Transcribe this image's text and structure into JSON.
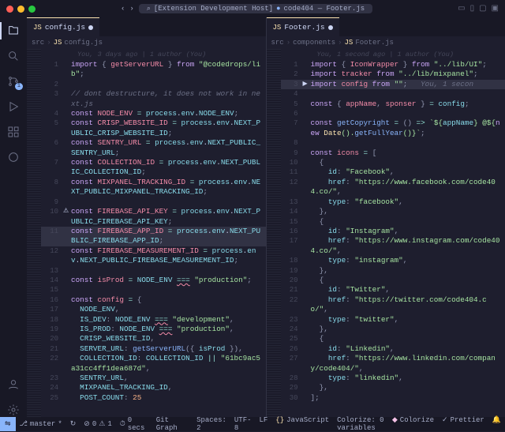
{
  "titlebar": {
    "search": "[Extension Development Host]",
    "project": "code404 — Footer.js"
  },
  "activity": {
    "scm_badge": "1"
  },
  "left": {
    "tab": "config.js",
    "crumbs": [
      "src",
      "config.js"
    ],
    "blame": "You, 3 days ago | 1 author (You)",
    "lines": [
      {
        "n": 1,
        "g": "",
        "html": "<span class='kw'>import</span> <span class='pun'>{</span> <span class='var'>getServerURL</span> <span class='pun'>}</span> <span class='kw'>from</span> <span class='str'>\"@codedrops/lib\"</span><span class='pun'>;</span>"
      },
      {
        "n": 2,
        "g": "",
        "html": ""
      },
      {
        "n": 3,
        "g": "",
        "html": "<span class='cm'>// dont destructure, it does not work in next.js</span>"
      },
      {
        "n": 4,
        "g": "",
        "html": "<span class='kw'>const</span> <span class='var'>NODE_ENV</span> <span class='op'>=</span> <span class='prop'>process</span>.<span class='prop'>env</span>.<span class='prop'>NODE_ENV</span><span class='pun'>;</span>"
      },
      {
        "n": 5,
        "g": "",
        "html": "<span class='kw'>const</span> <span class='var'>CRISP_WEBSITE_ID</span> <span class='op'>=</span> <span class='prop'>process</span>.<span class='prop'>env</span>.<span class='prop'>NEXT_PUBLIC_CRISP_WEBSITE_ID</span><span class='pun'>;</span>"
      },
      {
        "n": 6,
        "g": "",
        "html": "<span class='kw'>const</span> <span class='var'>SENTRY_URL</span> <span class='op'>=</span> <span class='prop'>process</span>.<span class='prop'>env</span>.<span class='prop'>NEXT_PUBLIC_SENTRY_URL</span><span class='pun'>;</span>"
      },
      {
        "n": 7,
        "g": "",
        "html": "<span class='kw'>const</span> <span class='var'>COLLECTION_ID</span> <span class='op'>=</span> <span class='prop'>process</span>.<span class='prop'>env</span>.<span class='prop'>NEXT_PUBLIC_COLLECTION_ID</span><span class='pun'>;</span>"
      },
      {
        "n": 8,
        "g": "",
        "html": "<span class='kw'>const</span> <span class='var'>MIXPANEL_TRACKING_ID</span> <span class='op'>=</span> <span class='prop'>process</span>.<span class='prop'>env</span>.<span class='prop'>NEXT_PUBLIC_MIXPANEL_TRACKING_ID</span><span class='pun'>;</span>"
      },
      {
        "n": 9,
        "g": "",
        "html": ""
      },
      {
        "n": 10,
        "g": "⚠",
        "html": "<span class='kw'>const</span> <span class='var'>FIREBASE_API_KEY</span> <span class='op'>=</span> <span class='prop'>process</span>.<span class='prop'>env</span>.<span class='prop'>NEXT_PUBLIC_FIREBASE_API_KEY</span><span class='pun'>;</span>"
      },
      {
        "n": 11,
        "g": "",
        "hl": true,
        "html": "<span class='kw'>const</span> <span class='var'>FIREBASE_APP_ID</span> <span class='op'>=</span> <span class='prop'>process</span>.<span class='prop'>env</span>.<span class='prop'>NEXT_PUBLIC_FIREBASE_APP_ID</span><span class='pun'>;</span>"
      },
      {
        "n": 12,
        "g": "",
        "html": "<span class='kw'>const</span> <span class='var'>FIREBASE_MEASUREMENT_ID</span> <span class='op'>=</span> <span class='prop'>process</span>.<span class='prop'>env</span>.<span class='prop'>NEXT_PUBLIC_FIREBASE_MEASUREMENT_ID</span><span class='pun'>;</span>"
      },
      {
        "n": 13,
        "g": "",
        "html": ""
      },
      {
        "n": 14,
        "g": "",
        "html": "<span class='kw'>const</span> <span class='var'>isProd</span> <span class='op'>=</span> <span class='prop'>NODE_ENV</span> <span class='op err'>===</span> <span class='str'>\"production\"</span><span class='pun'>;</span>"
      },
      {
        "n": 15,
        "g": "",
        "html": ""
      },
      {
        "n": 16,
        "g": "",
        "html": "<span class='kw'>const</span> <span class='var'>config</span> <span class='op'>=</span> <span class='pun'>{</span>"
      },
      {
        "n": 17,
        "g": "",
        "html": "  <span class='prop'>NODE_ENV</span><span class='pun'>,</span>"
      },
      {
        "n": 18,
        "g": "",
        "html": "  <span class='prop'>IS_DEV</span><span class='pun'>:</span> <span class='prop'>NODE_ENV</span> <span class='op err'>===</span> <span class='str'>\"development\"</span><span class='pun'>,</span>"
      },
      {
        "n": 19,
        "g": "",
        "html": "  <span class='prop'>IS_PROD</span><span class='pun'>:</span> <span class='prop'>NODE_ENV</span> <span class='op err'>===</span> <span class='str'>\"production\"</span><span class='pun'>,</span>"
      },
      {
        "n": 20,
        "g": "",
        "html": "  <span class='prop'>CRISP_WEBSITE_ID</span><span class='pun'>,</span>"
      },
      {
        "n": 21,
        "g": "",
        "html": "  <span class='prop'>SERVER_URL</span><span class='pun'>:</span> <span class='fn'>getServerURL</span><span class='pun'>({</span> <span class='prop'>isProd</span> <span class='pun'>}),</span>"
      },
      {
        "n": 22,
        "g": "",
        "html": "  <span class='prop'>COLLECTION_ID</span><span class='pun'>:</span> <span class='prop'>COLLECTION_ID</span> <span class='op'>||</span> <span class='str'>\"61bc9ac5a31cc4ff1dea687d\"</span><span class='pun'>,</span>"
      },
      {
        "n": 23,
        "g": "",
        "html": "  <span class='prop'>SENTRY_URL</span><span class='pun'>,</span>"
      },
      {
        "n": 24,
        "g": "",
        "html": "  <span class='prop'>MIXPANEL_TRACKING_ID</span><span class='pun'>,</span>"
      },
      {
        "n": 25,
        "g": "",
        "html": "  <span class='prop'>POST_COUNT</span><span class='pun'>:</span> <span class='num'>25</span>"
      }
    ]
  },
  "right": {
    "tab": "Footer.js",
    "crumbs": [
      "src",
      "components",
      "Footer.js"
    ],
    "blame": "You, 1 second ago | 1 author (You)",
    "lines": [
      {
        "n": 1,
        "g": "",
        "html": "<span class='kw'>import</span> <span class='pun'>{</span> <span class='var'>IconWrapper</span> <span class='pun'>}</span> <span class='kw'>from</span> <span class='str'>\"../lib/UI\"</span><span class='pun'>;</span>"
      },
      {
        "n": 2,
        "g": "",
        "html": "<span class='kw'>import</span> <span class='var'>tracker</span> <span class='kw'>from</span> <span class='str'>\"../lib/mixpanel\"</span><span class='pun'>;</span>"
      },
      {
        "n": 3,
        "g": "▶",
        "hl": true,
        "html": "<span class='kw'>import</span> <span class='var'>config</span> <span class='kw'>from</span> <span class='str'>\"\"</span><span class='pun'>;</span>   <span class='cm'>You, 1 secon</span>"
      },
      {
        "n": 4,
        "g": "",
        "html": ""
      },
      {
        "n": 5,
        "g": "",
        "html": "<span class='kw'>const</span> <span class='pun'>{</span> <span class='var'>appName</span><span class='pun'>,</span> <span class='var'>sponser</span> <span class='pun'>}</span> <span class='op'>=</span> <span class='prop'>config</span><span class='pun'>;</span>"
      },
      {
        "n": 6,
        "g": "",
        "html": ""
      },
      {
        "n": 7,
        "g": "",
        "html": "<span class='kw'>const</span> <span class='fn'>getCopyright</span> <span class='op'>=</span> <span class='pun'>()</span> <span class='op'>=></span> <span class='str'>`${<span class='prop'>appName</span>} @${<span class='kw'>new</span> <span class='cls'>Date</span>().<span class='fn'>getFullYear</span>()}`</span><span class='pun'>;</span>"
      },
      {
        "n": 8,
        "g": "",
        "html": ""
      },
      {
        "n": 9,
        "g": "",
        "html": "<span class='kw'>const</span> <span class='var'>icons</span> <span class='op'>=</span> <span class='pun'>[</span>"
      },
      {
        "n": 10,
        "g": "",
        "html": "  <span class='pun'>{</span>"
      },
      {
        "n": 11,
        "g": "",
        "html": "    <span class='prop'>id</span><span class='pun'>:</span> <span class='str'>\"Facebook\"</span><span class='pun'>,</span>"
      },
      {
        "n": 12,
        "g": "",
        "html": "    <span class='prop'>href</span><span class='pun'>:</span> <span class='str'>\"https://www.facebook.com/code404.co/\"</span><span class='pun'>,</span>"
      },
      {
        "n": 13,
        "g": "",
        "html": "    <span class='prop'>type</span><span class='pun'>:</span> <span class='str'>\"facebook\"</span><span class='pun'>,</span>"
      },
      {
        "n": 14,
        "g": "",
        "html": "  <span class='pun'>},</span>"
      },
      {
        "n": 15,
        "g": "",
        "html": "  <span class='pun'>{</span>"
      },
      {
        "n": 16,
        "g": "",
        "html": "    <span class='prop'>id</span><span class='pun'>:</span> <span class='str'>\"Instagram\"</span><span class='pun'>,</span>"
      },
      {
        "n": 17,
        "g": "",
        "html": "    <span class='prop'>href</span><span class='pun'>:</span> <span class='str'>\"https://www.instagram.com/code404.co/\"</span><span class='pun'>,</span>"
      },
      {
        "n": 18,
        "g": "",
        "html": "    <span class='prop'>type</span><span class='pun'>:</span> <span class='str'>\"instagram\"</span><span class='pun'>,</span>"
      },
      {
        "n": 19,
        "g": "",
        "html": "  <span class='pun'>},</span>"
      },
      {
        "n": 20,
        "g": "",
        "html": "  <span class='pun'>{</span>"
      },
      {
        "n": 21,
        "g": "",
        "html": "    <span class='prop'>id</span><span class='pun'>:</span> <span class='str'>\"Twitter\"</span><span class='pun'>,</span>"
      },
      {
        "n": 22,
        "g": "",
        "html": "    <span class='prop'>href</span><span class='pun'>:</span> <span class='str'>\"https://twitter.com/code404.co/\"</span><span class='pun'>,</span>"
      },
      {
        "n": 23,
        "g": "",
        "html": "    <span class='prop'>type</span><span class='pun'>:</span> <span class='str'>\"twitter\"</span><span class='pun'>,</span>"
      },
      {
        "n": 24,
        "g": "",
        "html": "  <span class='pun'>},</span>"
      },
      {
        "n": 25,
        "g": "",
        "html": "  <span class='pun'>{</span>"
      },
      {
        "n": 26,
        "g": "",
        "html": "    <span class='prop'>id</span><span class='pun'>:</span> <span class='str'>\"Linkedin\"</span><span class='pun'>,</span>"
      },
      {
        "n": 27,
        "g": "",
        "html": "    <span class='prop'>href</span><span class='pun'>:</span> <span class='str'>\"https://www.linkedin.com/company/code404/\"</span><span class='pun'>,</span>"
      },
      {
        "n": 28,
        "g": "",
        "html": "    <span class='prop'>type</span><span class='pun'>:</span> <span class='str'>\"linkedin\"</span><span class='pun'>,</span>"
      },
      {
        "n": 29,
        "g": "",
        "html": "  <span class='pun'>},</span>"
      },
      {
        "n": 30,
        "g": "",
        "html": "<span class='pun'>];</span>"
      }
    ]
  },
  "status": {
    "branch": "master",
    "sync": "↻",
    "errors": "0",
    "warnings": "1",
    "time": "0 secs",
    "gitgraph": "Git Graph",
    "spaces": "Spaces: 2",
    "encoding": "UTF-8",
    "eol": "LF",
    "lang": "JavaScript",
    "colorize": "Colorize: 0 variables",
    "col": "Colorize",
    "prettier": "Prettier"
  }
}
